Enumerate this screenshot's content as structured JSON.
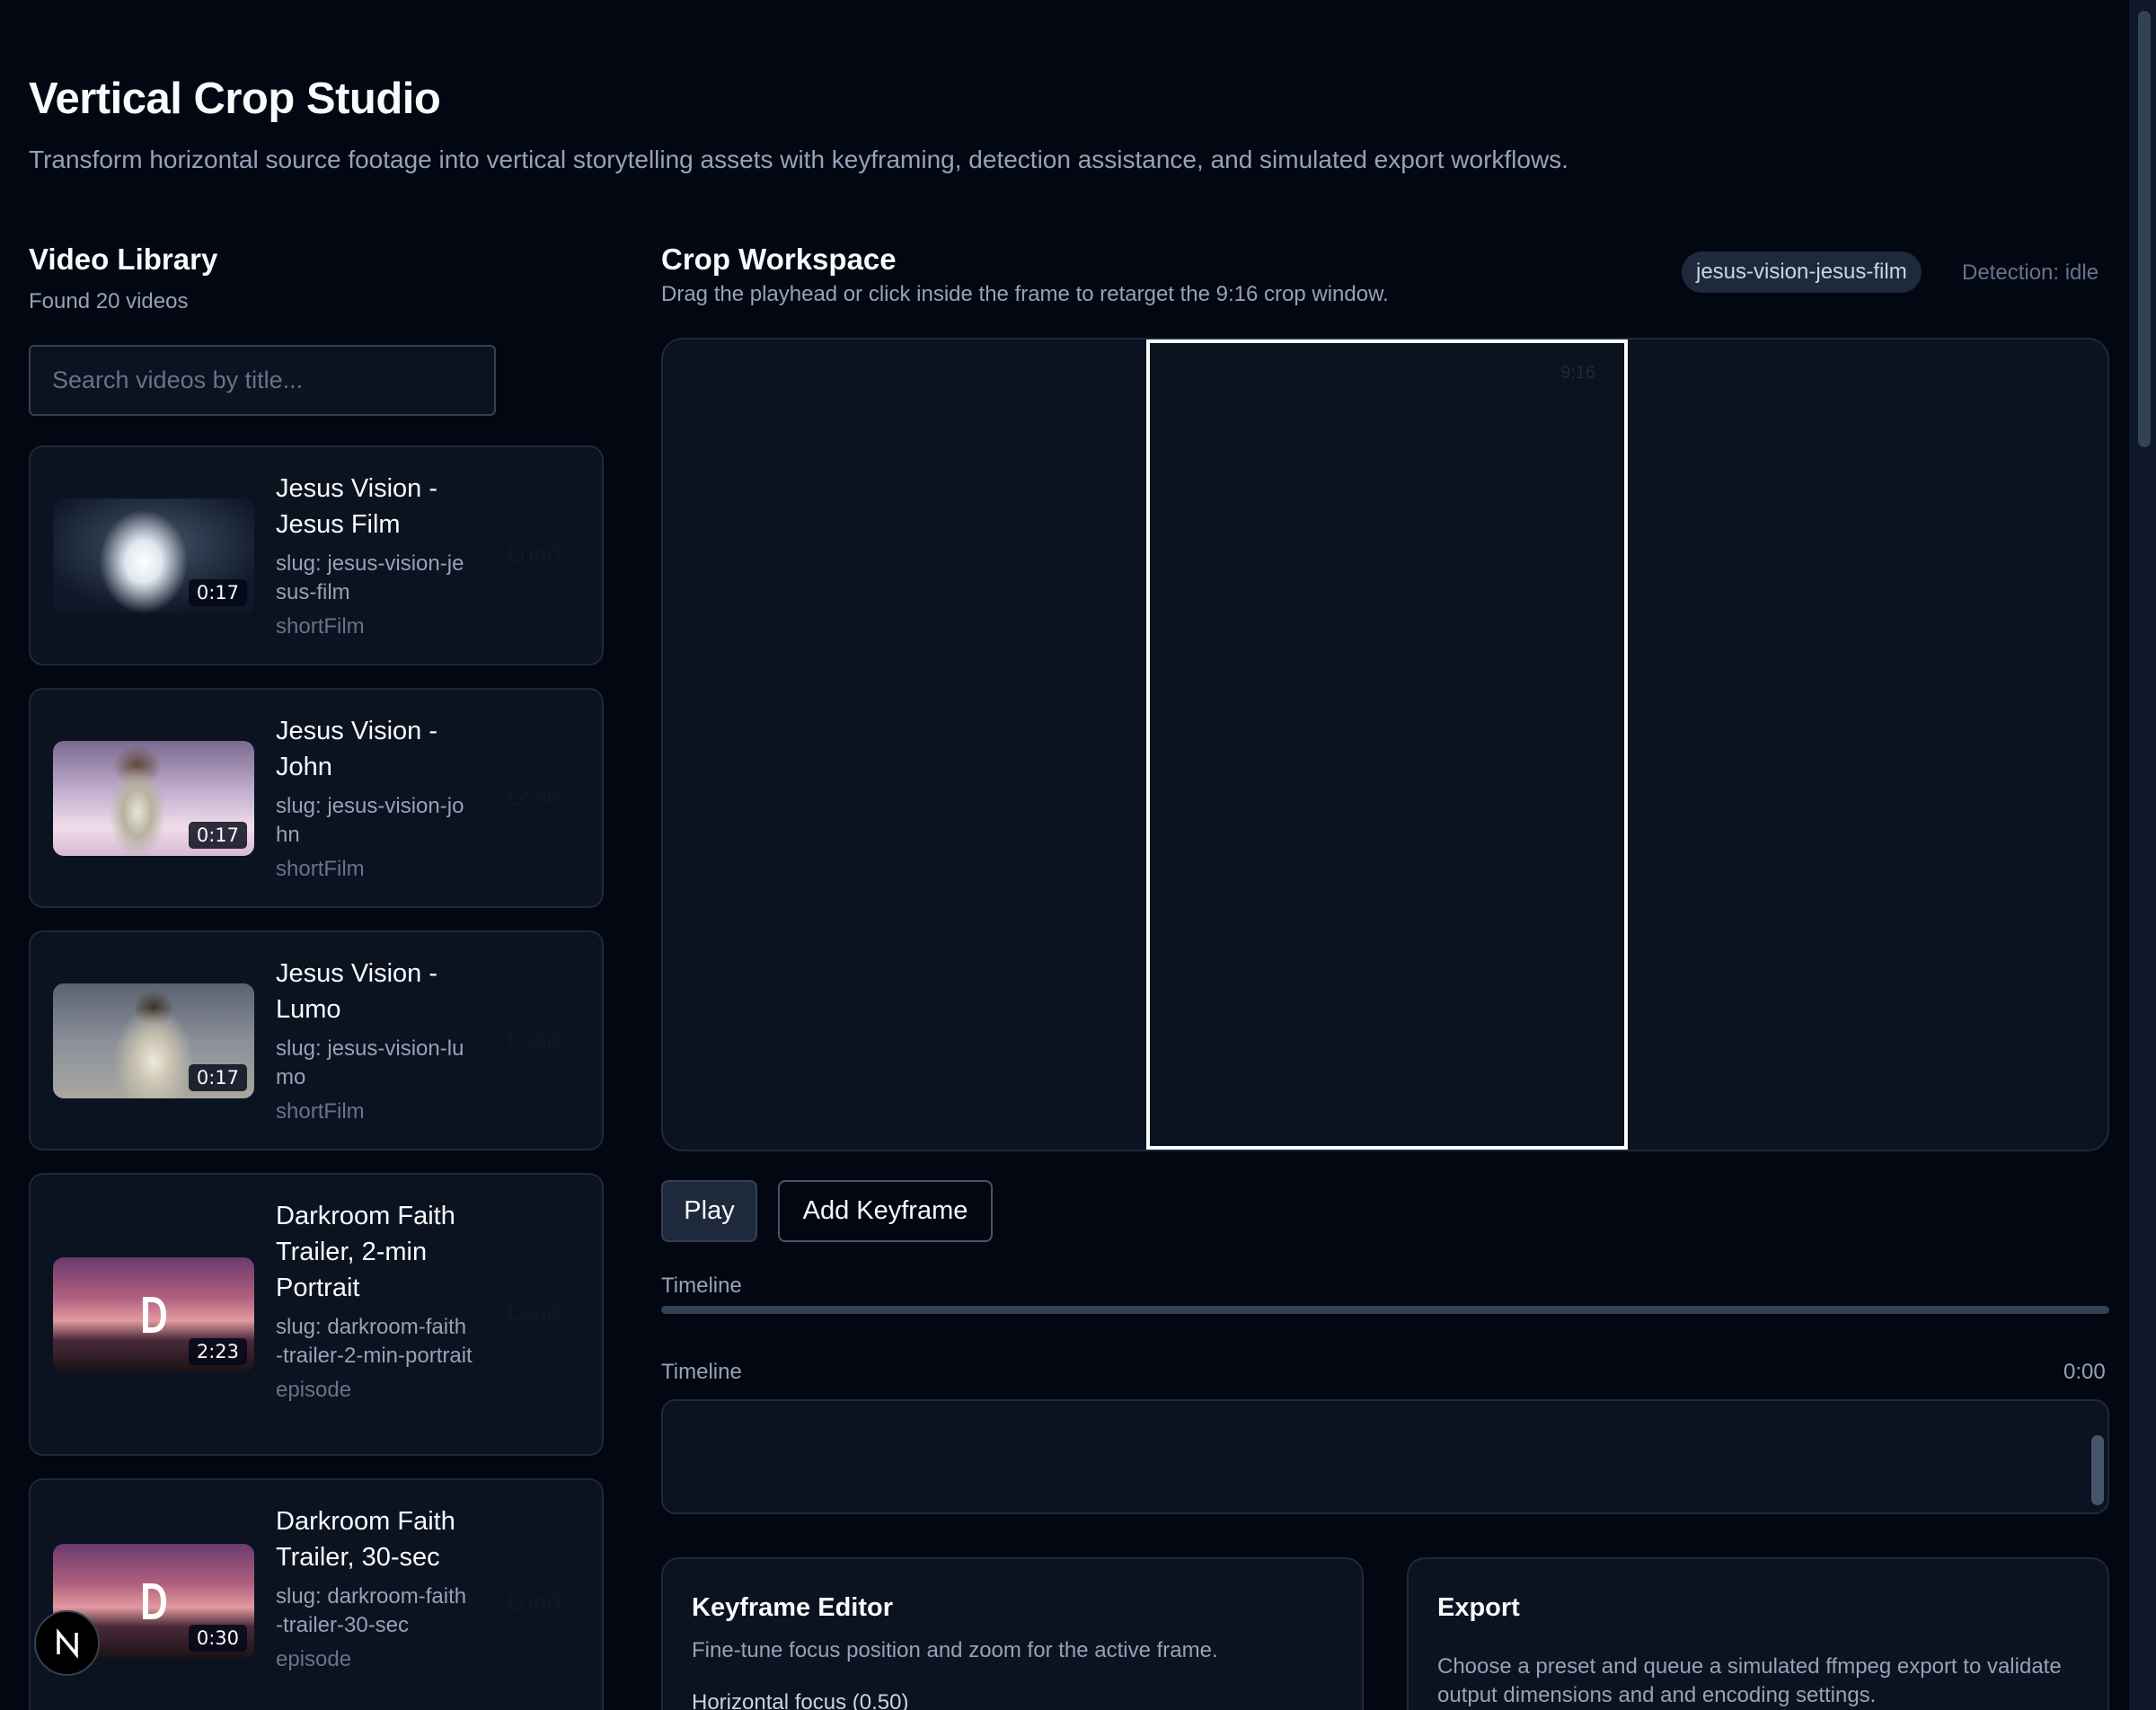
{
  "header": {
    "title": "Vertical Crop Studio",
    "subtitle": "Transform horizontal source footage into vertical storytelling assets with keyframing, detection assistance, and simulated export workflows."
  },
  "library": {
    "title": "Video Library",
    "count_text": "Found 20 videos",
    "search_placeholder": "Search videos by title...",
    "load_label": "Load",
    "videos": [
      {
        "title": "Jesus Vision - Jesus Film",
        "slug": "slug: jesus-vision-jesus-film",
        "type": "shortFilm",
        "duration": "0:17"
      },
      {
        "title": "Jesus Vision - John",
        "slug": "slug: jesus-vision-john",
        "type": "shortFilm",
        "duration": "0:17"
      },
      {
        "title": "Jesus Vision - Lumo",
        "slug": "slug: jesus-vision-lumo",
        "type": "shortFilm",
        "duration": "0:17"
      },
      {
        "title": "Darkroom Faith Trailer, 2-min Portrait",
        "slug": "slug: darkroom-faith-trailer-2-min-portrait",
        "type": "episode",
        "duration": "2:23"
      },
      {
        "title": "Darkroom Faith Trailer, 30-sec",
        "slug": "slug: darkroom-faith-trailer-30-sec",
        "type": "episode",
        "duration": "0:30"
      }
    ]
  },
  "workspace": {
    "title": "Crop Workspace",
    "description": "Drag the playhead or click inside the frame to retarget the 9:16 crop window.",
    "active_slug": "jesus-vision-jesus-film",
    "detection_status": "Detection: idle",
    "crop_label": "9:16",
    "play_label": "Play",
    "add_keyframe_label": "Add Keyframe",
    "timeline_label": "Timeline",
    "timeline_label_2": "Timeline",
    "timeline_time": "0:00"
  },
  "keyframe_editor": {
    "title": "Keyframe Editor",
    "description": "Fine-tune focus position and zoom for the active frame.",
    "field_label": "Horizontal focus (0.50)"
  },
  "export": {
    "title": "Export",
    "description": "Choose a preset and queue a simulated ffmpeg export to validate output dimensions and and encoding settings."
  },
  "floating_button": {
    "icon": "next-logo-icon"
  },
  "colors": {
    "background": "#030712",
    "panel": "#0b1220",
    "border": "#1e293b",
    "muted_text": "#94a3b8",
    "accent_white": "#f8fafc"
  }
}
